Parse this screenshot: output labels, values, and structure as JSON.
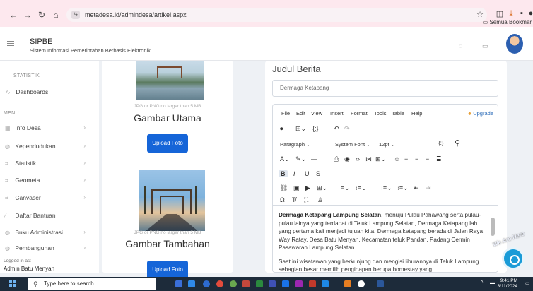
{
  "browser": {
    "url": "metadesa.id/admindesa/artikel.aspx",
    "bookmarks_label": "Semua Bookmar",
    "nav_icons": [
      "back-icon",
      "forward-icon",
      "reload-icon",
      "home-icon"
    ]
  },
  "header": {
    "app_title": "SIPBE",
    "app_subtitle": "Sistem Informasi Pemerintahan Berbasis Elektronik"
  },
  "sidebar": {
    "section_statistik": "STATISTIK",
    "dashboards": "Dashboards",
    "section_menu": "MENU",
    "items": [
      {
        "label": "Info Desa",
        "icon": "grid-icon",
        "has_chevron": true
      },
      {
        "label": "Kependudukan",
        "icon": "globe-icon",
        "has_chevron": true
      },
      {
        "label": "Statistik",
        "icon": "chart-icon",
        "has_chevron": true
      },
      {
        "label": "Geometa",
        "icon": "map-icon",
        "has_chevron": true
      },
      {
        "label": "Canvaser",
        "icon": "canvas-icon",
        "has_chevron": true
      },
      {
        "label": "Daftar Bantuan",
        "icon": "list-icon",
        "has_chevron": false
      },
      {
        "label": "Buku Administrasi",
        "icon": "book-icon",
        "has_chevron": true
      },
      {
        "label": "Pembangunan",
        "icon": "build-icon",
        "has_chevron": true
      }
    ],
    "logged_in_label": "Logged in as:",
    "logged_in_user": "Admin Batu Menyan"
  },
  "left_card": {
    "hint_top": "JPG or PNG no larger than 5 MB",
    "title_main": "Gambar Utama",
    "upload_label": "Upload Foto",
    "hint_bottom": "JPG or PNG no larger than 5 MB",
    "title_extra": "Gambar Tambahan",
    "upload_label_2": "Upload Foto"
  },
  "editor": {
    "heading": "Judul Berita",
    "title_value": "Dermaga Ketapang",
    "menus": [
      "File",
      "Edit",
      "View",
      "Insert",
      "Format",
      "Tools",
      "Table",
      "Help"
    ],
    "upgrade_label": "Upgrade",
    "paragraph_select": "Paragraph",
    "font_select": "System Font",
    "size_select": "12pt",
    "body_bold": "Dermaga Ketapang Lampung Selatan",
    "body_p1_rest": ", menuju Pulau Pahawang serta pulau-pulau lainya yang terdapat di Teluk Lampung Selatan, Dermaga Ketapang lah yang pertama kali menjadi tujuan kita. Dermaga ketapang berada di Jalan Raya Way Ratay, Desa Batu Menyan, Kecamatan teluk Pandan, Padang Cermin Pasawaran Lampung Selatan.",
    "body_p2": "Saat ini wisatawan yang berkunjung dan mengisi liburannya di Teluk Lampung sebagian besar memilih penginapan berupa homestay yang"
  },
  "help_badge": "We Are Here",
  "taskbar": {
    "search_placeholder": "Type here to search",
    "time": "9:41 PM",
    "date": "3/11/2024"
  },
  "colors": {
    "primary_button": "#1565d8",
    "chrome_bg": "#fde8ee",
    "taskbar_bg": "#1d2b3a"
  }
}
